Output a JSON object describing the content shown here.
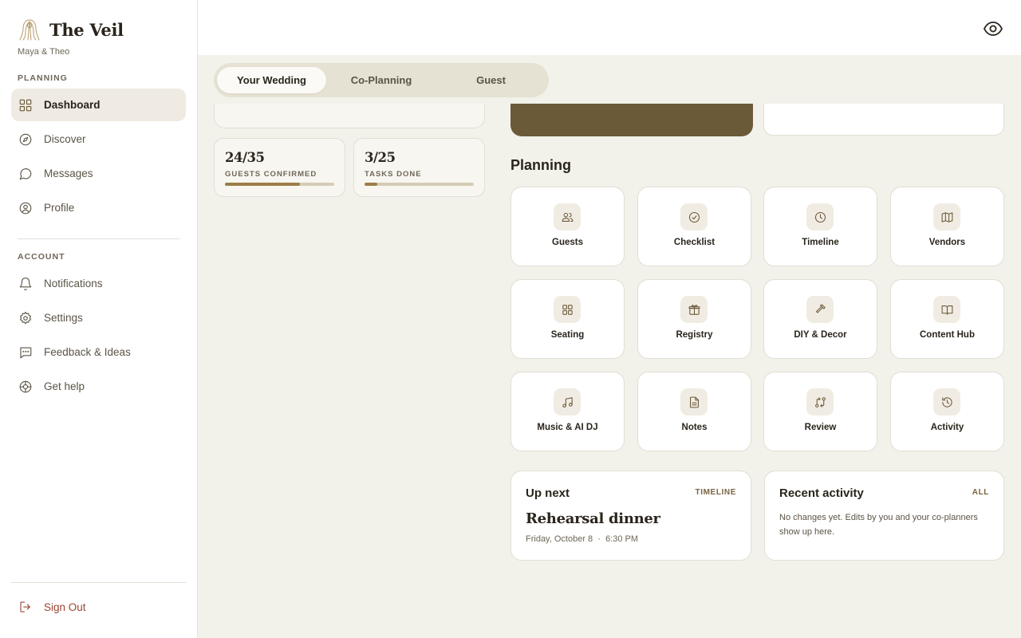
{
  "brand": {
    "name": "The Veil",
    "couple": "Maya & Theo"
  },
  "sidebar": {
    "planning_label": "PLANNING",
    "account_label": "ACCOUNT",
    "planning_items": [
      {
        "label": "Dashboard",
        "icon": "grid-icon",
        "active": true
      },
      {
        "label": "Discover",
        "icon": "compass-icon"
      },
      {
        "label": "Messages",
        "icon": "message-icon"
      },
      {
        "label": "Profile",
        "icon": "user-circle-icon"
      }
    ],
    "account_items": [
      {
        "label": "Notifications",
        "icon": "bell-icon"
      },
      {
        "label": "Settings",
        "icon": "gear-icon"
      },
      {
        "label": "Feedback & Ideas",
        "icon": "chat-dots-icon"
      },
      {
        "label": "Get help",
        "icon": "lifebuoy-icon"
      }
    ],
    "sign_out": "Sign Out"
  },
  "tabs": [
    {
      "label": "Your Wedding",
      "active": true
    },
    {
      "label": "Co-Planning"
    },
    {
      "label": "Guest"
    }
  ],
  "stats": [
    {
      "value": "24/35",
      "label": "GUESTS CONFIRMED",
      "progress": 0.686
    },
    {
      "value": "3/25",
      "label": "TASKS DONE",
      "progress": 0.12
    }
  ],
  "planning": {
    "title": "Planning",
    "tiles": [
      {
        "label": "Guests",
        "icon": "users-icon"
      },
      {
        "label": "Checklist",
        "icon": "check-circle-icon"
      },
      {
        "label": "Timeline",
        "icon": "clock-icon"
      },
      {
        "label": "Vendors",
        "icon": "map-icon"
      },
      {
        "label": "Seating",
        "icon": "grid-icon"
      },
      {
        "label": "Registry",
        "icon": "gift-icon"
      },
      {
        "label": "DIY & Decor",
        "icon": "hammer-icon"
      },
      {
        "label": "Content Hub",
        "icon": "book-open-icon"
      },
      {
        "label": "Music & AI DJ",
        "icon": "music-icon"
      },
      {
        "label": "Notes",
        "icon": "file-text-icon"
      },
      {
        "label": "Review",
        "icon": "git-compare-icon"
      },
      {
        "label": "Activity",
        "icon": "history-icon"
      }
    ]
  },
  "up_next": {
    "title": "Up next",
    "link": "TIMELINE",
    "event": "Rehearsal dinner",
    "date": "Friday, October 8",
    "separator": "·",
    "time": "6:30 PM"
  },
  "recent_activity": {
    "title": "Recent activity",
    "link": "ALL",
    "empty": "No changes yet. Edits by you and your co-planners show up here."
  },
  "colors": {
    "accent": "#6b5a38",
    "background": "#f2f1ea",
    "danger": "#9a4630",
    "progress_fill": "#9c7e49"
  }
}
